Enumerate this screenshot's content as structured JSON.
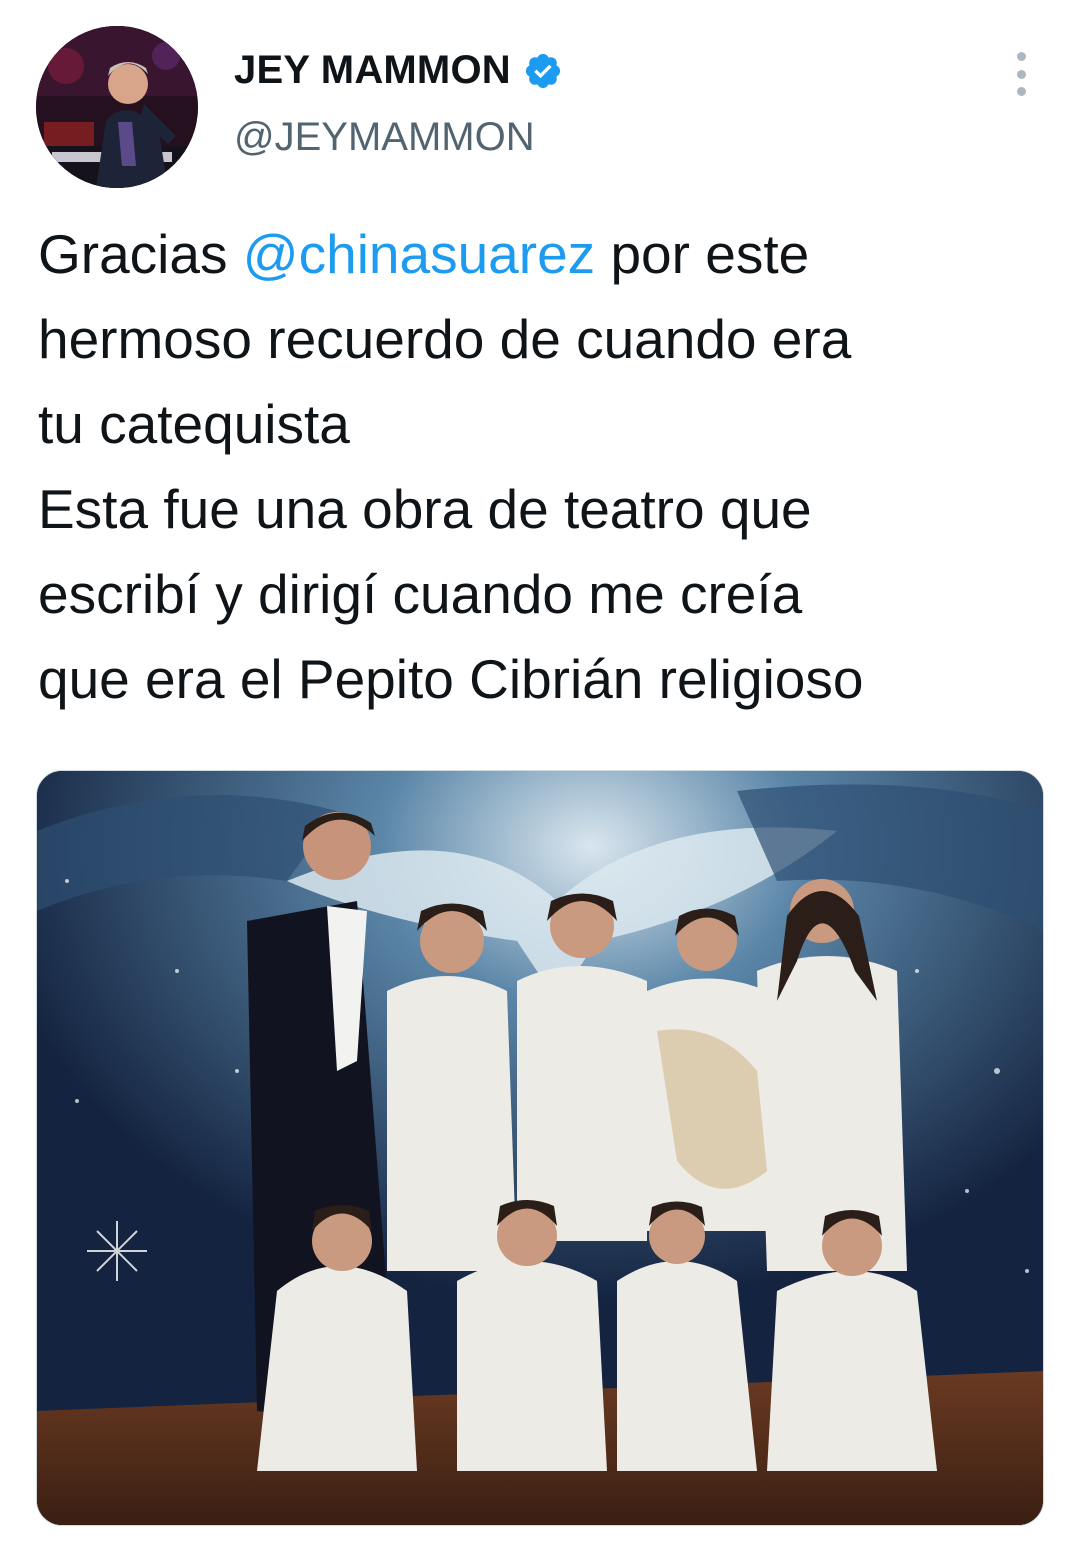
{
  "tweet": {
    "author": {
      "display_name": "JEY MAMMON",
      "handle": "@JEYMAMMON",
      "verified": true,
      "avatar_icon": "profile-photo-pianist"
    },
    "more_icon": "vertical-ellipsis-icon",
    "text": {
      "line1_before": "Gracias ",
      "mention": "@chinasuarez",
      "line1_after": " por este",
      "line2": "hermoso recuerdo de cuando era",
      "line3": "tu catequista",
      "line4": "Esta fue una obra de teatro que",
      "line5": "escribí y dirigí cuando me creía",
      "line6": "que era el Pepito Cibrián religioso"
    },
    "media": {
      "kind": "photo"
    }
  },
  "colors": {
    "link": "#1d9bf0",
    "verified_badge": "#1d9bf0",
    "secondary_text": "#536471",
    "primary_text": "#0f1419"
  }
}
